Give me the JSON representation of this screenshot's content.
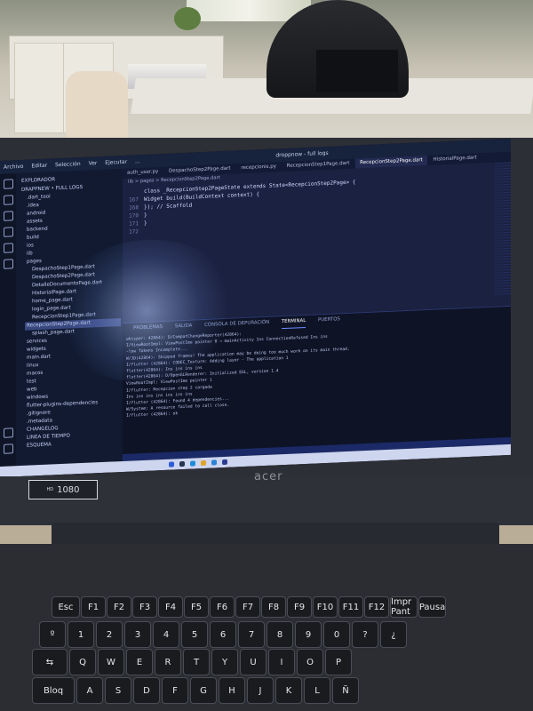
{
  "scene": {
    "description_tags": [
      "laptop",
      "office",
      "code-editor",
      "keyboard"
    ],
    "brand": "acer",
    "badge": {
      "left": "HD",
      "right": "1080"
    }
  },
  "window": {
    "menus": [
      "Archivo",
      "Editar",
      "Selección",
      "Ver",
      "Ejecutar",
      "..."
    ],
    "title": "droppnow - full logs"
  },
  "sidebar": {
    "title": "EXPLORADOR",
    "root": "DRAPPNEW • FULL LOGS",
    "items": [
      ".dart_tool",
      ".idea",
      "android",
      "assets",
      "backend",
      "build",
      "ios",
      "lib",
      "pages",
      "DespachoStep1Page.dart",
      "DespachoStep2Page.dart",
      "DetalleDocumentoPage.dart",
      "HistorialPage.dart",
      "home_page.dart",
      "login_page.dart",
      "RecepcionStep1Page.dart",
      "RecepcionStep2Page.dart",
      "splash_page.dart",
      "services",
      "widgets",
      "main.dart",
      "linux",
      "macos",
      "test",
      "web",
      "windows",
      "flutter-plugins-dependencies",
      ".gitignore",
      ".metadata",
      "CHANGELOG",
      "LINEA DE TIEMPO",
      "ESQUEMA"
    ]
  },
  "editor": {
    "tabs": [
      "auth_user.py",
      "DespachoStep2Page.dart",
      "recepcionis.py",
      "RecepcionStep1Page.dart",
      "RecepcionStep2Page.dart",
      "HistorialPage.dart"
    ],
    "active_tab": "RecepcionStep2Page.dart",
    "breadcrumb": "lib > pages > RecepcionStep2Page.dart",
    "lines": [
      {
        "n": "",
        "text": "class _RecepcionStep2PageState extends State<RecepcionStep2Page> {"
      },
      {
        "n": "167",
        "text": "  Widget build(BuildContext context) {"
      },
      {
        "n": "168",
        "text": "  }); // Scaffold"
      },
      {
        "n": "170",
        "text": "  }"
      },
      {
        "n": "171",
        "text": "}"
      },
      {
        "n": "172",
        "text": ""
      }
    ]
  },
  "panel": {
    "tabs": [
      "PROBLEMAS",
      "SALIDA",
      "CONSOLA DE DEPURACIÓN",
      "TERMINAL",
      "PUERTOS"
    ],
    "active_tab": "TERMINAL",
    "terminal_lines": [
      "whisper: 42864): D/CompatChangeReporter(42864):",
      "I/ViewRootImpl: ViewPostIme pointer 0 → mainActivity  Ins ConnectionRefused Ins   ins",
      "-low Tokens Incomplete...",
      "W/JD(42864):  Skipped frames! The application may be doing too much work on its main thread.",
      "I/flutter (42864): CODEC_Texture: Adding layer - The application 1",
      "flutter(42864): Ins   ins   ins   ins",
      "flutter(42864): D/OpenGLRenderer: Initialized EGL, version 1.4",
      "ViewRootImpl: ViewPostIme pointer 1",
      "I/flutter: Recepcion step 2 cargada",
      "Ins   ins   ins   ins   ins   ins   ins",
      "I/flutter (42864): Found 4 dependencies...",
      "W/System: A resource failed to call close.",
      "I/flutter (42864): ok"
    ]
  }
}
